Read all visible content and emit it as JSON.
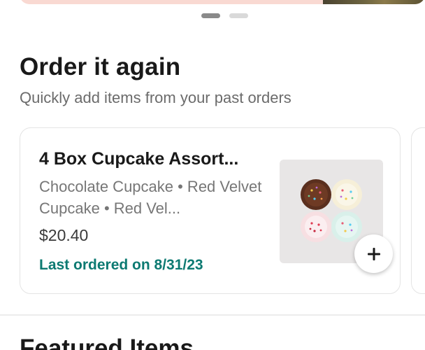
{
  "carousel": {
    "page_count": 2,
    "active_index": 0
  },
  "order_again": {
    "title": "Order it again",
    "subtitle": "Quickly add items from your past orders",
    "item": {
      "name": "4 Box Cupcake Assort...",
      "description": "Chocolate Cupcake • Red Velvet Cupcake • Red Vel...",
      "price": "$20.40",
      "last_ordered": "Last ordered on 8/31/23",
      "add_icon": "plus-icon"
    }
  },
  "next_section": {
    "title": "Featured Items"
  },
  "colors": {
    "accent_teal": "#0d7a72",
    "banner_pink": "#f9d9d2"
  }
}
